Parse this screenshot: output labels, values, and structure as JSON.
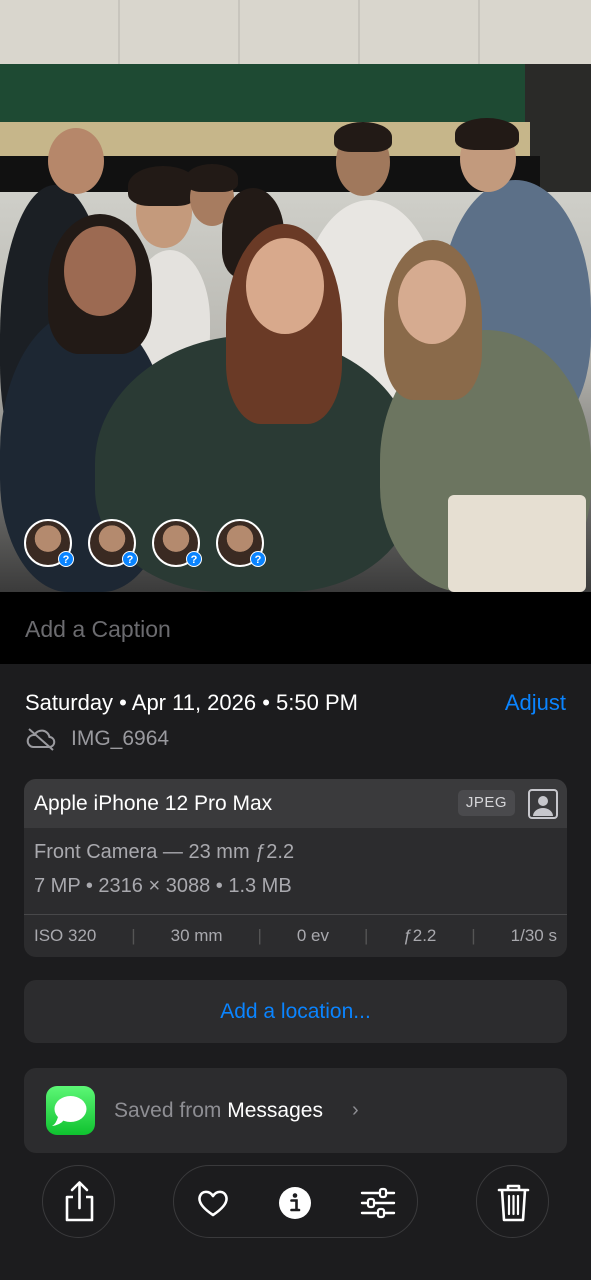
{
  "photo": {
    "face_chips": [
      {
        "badge": "?"
      },
      {
        "badge": "?"
      },
      {
        "badge": "?"
      },
      {
        "badge": "?"
      }
    ]
  },
  "caption": {
    "placeholder": "Add a Caption"
  },
  "info": {
    "date": "Saturday • Apr 11, 2026 • 5:50 PM",
    "adjust_label": "Adjust",
    "filename": "IMG_6964"
  },
  "camera": {
    "device": "Apple iPhone 12 Pro Max",
    "format": "JPEG",
    "lens": "Front Camera — 23 mm ƒ2.2",
    "details": "7 MP • 2316 × 3088 • 1.3 MB",
    "specs": [
      "ISO 320",
      "30 mm",
      "0 ev",
      "ƒ2.2",
      "1/30 s"
    ]
  },
  "location": {
    "label": "Add a location..."
  },
  "source": {
    "prefix": "Saved from",
    "app": "Messages",
    "chevron": "›"
  },
  "colors": {
    "accent": "#0a84ff",
    "background": "#1c1c1e",
    "card": "#2c2c2e"
  },
  "icons": [
    "icloud-off-icon",
    "photo-icon",
    "messages-icon",
    "share-icon",
    "heart-icon",
    "info-icon",
    "sliders-icon",
    "trash-icon"
  ]
}
